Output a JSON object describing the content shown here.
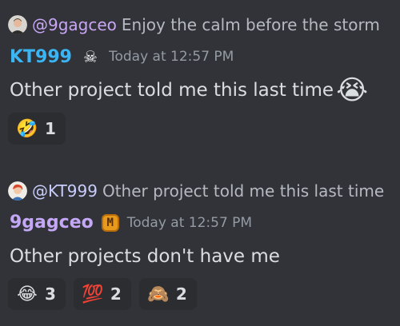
{
  "messages": [
    {
      "reply": {
        "avatar_icon": "user-avatar-man",
        "mention": "@9gagceo",
        "mention_color": "#c9a6f5",
        "text": "Enjoy the calm before the storm"
      },
      "author": {
        "name": "KT999",
        "color": "#3bb6f5",
        "badge_icon": "skull-crossbones-icon",
        "badge_glyph": "☠"
      },
      "timestamp": "Today at 12:57 PM",
      "content": "Other project told me this last time",
      "content_emoji": "😭",
      "reactions": [
        {
          "emoji": "🤣",
          "icon": "rofl-emoji-icon",
          "count": "1"
        }
      ]
    },
    {
      "reply": {
        "avatar_icon": "user-avatar-red-hair",
        "mention": "@KT999",
        "mention_color": "#c9cdfb",
        "text": "Other project told me this last time"
      },
      "author": {
        "name": "9gagceo",
        "color": "#c4a7f5",
        "badge_icon": "m-coin-icon",
        "badge_glyph": "M"
      },
      "timestamp": "Today at 12:57 PM",
      "content": "Other projects don't have me",
      "reactions": [
        {
          "emoji": "😂",
          "icon": "joy-emoji-icon",
          "count": "3"
        },
        {
          "emoji": "💯",
          "icon": "hundred-points-icon",
          "count": "2"
        },
        {
          "emoji": "🙈",
          "icon": "custom-mascot-icon",
          "count": "2"
        }
      ]
    }
  ]
}
